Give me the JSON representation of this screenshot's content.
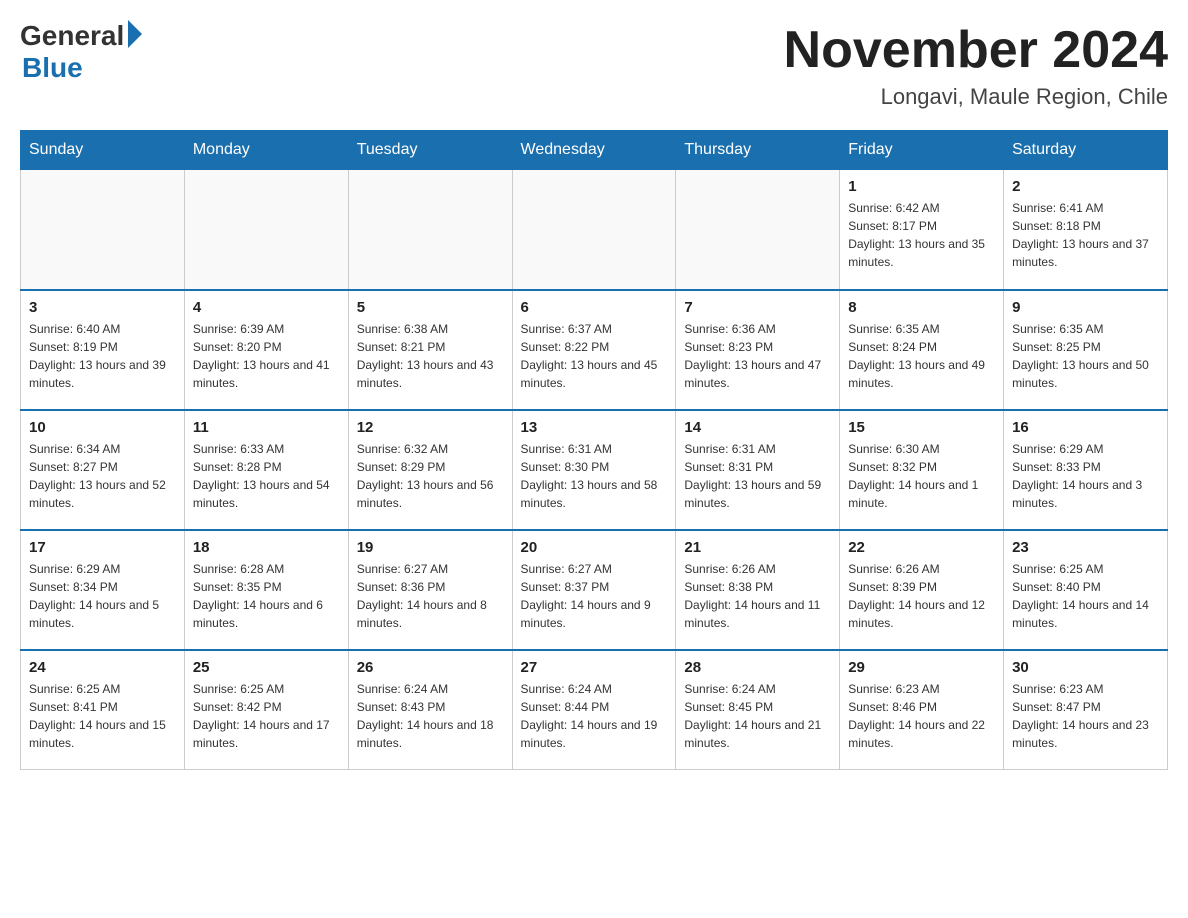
{
  "header": {
    "logo_general": "General",
    "logo_blue": "Blue",
    "month_title": "November 2024",
    "location": "Longavi, Maule Region, Chile"
  },
  "days_of_week": [
    "Sunday",
    "Monday",
    "Tuesday",
    "Wednesday",
    "Thursday",
    "Friday",
    "Saturday"
  ],
  "weeks": [
    [
      {
        "day": "",
        "info": ""
      },
      {
        "day": "",
        "info": ""
      },
      {
        "day": "",
        "info": ""
      },
      {
        "day": "",
        "info": ""
      },
      {
        "day": "",
        "info": ""
      },
      {
        "day": "1",
        "info": "Sunrise: 6:42 AM\nSunset: 8:17 PM\nDaylight: 13 hours and 35 minutes."
      },
      {
        "day": "2",
        "info": "Sunrise: 6:41 AM\nSunset: 8:18 PM\nDaylight: 13 hours and 37 minutes."
      }
    ],
    [
      {
        "day": "3",
        "info": "Sunrise: 6:40 AM\nSunset: 8:19 PM\nDaylight: 13 hours and 39 minutes."
      },
      {
        "day": "4",
        "info": "Sunrise: 6:39 AM\nSunset: 8:20 PM\nDaylight: 13 hours and 41 minutes."
      },
      {
        "day": "5",
        "info": "Sunrise: 6:38 AM\nSunset: 8:21 PM\nDaylight: 13 hours and 43 minutes."
      },
      {
        "day": "6",
        "info": "Sunrise: 6:37 AM\nSunset: 8:22 PM\nDaylight: 13 hours and 45 minutes."
      },
      {
        "day": "7",
        "info": "Sunrise: 6:36 AM\nSunset: 8:23 PM\nDaylight: 13 hours and 47 minutes."
      },
      {
        "day": "8",
        "info": "Sunrise: 6:35 AM\nSunset: 8:24 PM\nDaylight: 13 hours and 49 minutes."
      },
      {
        "day": "9",
        "info": "Sunrise: 6:35 AM\nSunset: 8:25 PM\nDaylight: 13 hours and 50 minutes."
      }
    ],
    [
      {
        "day": "10",
        "info": "Sunrise: 6:34 AM\nSunset: 8:27 PM\nDaylight: 13 hours and 52 minutes."
      },
      {
        "day": "11",
        "info": "Sunrise: 6:33 AM\nSunset: 8:28 PM\nDaylight: 13 hours and 54 minutes."
      },
      {
        "day": "12",
        "info": "Sunrise: 6:32 AM\nSunset: 8:29 PM\nDaylight: 13 hours and 56 minutes."
      },
      {
        "day": "13",
        "info": "Sunrise: 6:31 AM\nSunset: 8:30 PM\nDaylight: 13 hours and 58 minutes."
      },
      {
        "day": "14",
        "info": "Sunrise: 6:31 AM\nSunset: 8:31 PM\nDaylight: 13 hours and 59 minutes."
      },
      {
        "day": "15",
        "info": "Sunrise: 6:30 AM\nSunset: 8:32 PM\nDaylight: 14 hours and 1 minute."
      },
      {
        "day": "16",
        "info": "Sunrise: 6:29 AM\nSunset: 8:33 PM\nDaylight: 14 hours and 3 minutes."
      }
    ],
    [
      {
        "day": "17",
        "info": "Sunrise: 6:29 AM\nSunset: 8:34 PM\nDaylight: 14 hours and 5 minutes."
      },
      {
        "day": "18",
        "info": "Sunrise: 6:28 AM\nSunset: 8:35 PM\nDaylight: 14 hours and 6 minutes."
      },
      {
        "day": "19",
        "info": "Sunrise: 6:27 AM\nSunset: 8:36 PM\nDaylight: 14 hours and 8 minutes."
      },
      {
        "day": "20",
        "info": "Sunrise: 6:27 AM\nSunset: 8:37 PM\nDaylight: 14 hours and 9 minutes."
      },
      {
        "day": "21",
        "info": "Sunrise: 6:26 AM\nSunset: 8:38 PM\nDaylight: 14 hours and 11 minutes."
      },
      {
        "day": "22",
        "info": "Sunrise: 6:26 AM\nSunset: 8:39 PM\nDaylight: 14 hours and 12 minutes."
      },
      {
        "day": "23",
        "info": "Sunrise: 6:25 AM\nSunset: 8:40 PM\nDaylight: 14 hours and 14 minutes."
      }
    ],
    [
      {
        "day": "24",
        "info": "Sunrise: 6:25 AM\nSunset: 8:41 PM\nDaylight: 14 hours and 15 minutes."
      },
      {
        "day": "25",
        "info": "Sunrise: 6:25 AM\nSunset: 8:42 PM\nDaylight: 14 hours and 17 minutes."
      },
      {
        "day": "26",
        "info": "Sunrise: 6:24 AM\nSunset: 8:43 PM\nDaylight: 14 hours and 18 minutes."
      },
      {
        "day": "27",
        "info": "Sunrise: 6:24 AM\nSunset: 8:44 PM\nDaylight: 14 hours and 19 minutes."
      },
      {
        "day": "28",
        "info": "Sunrise: 6:24 AM\nSunset: 8:45 PM\nDaylight: 14 hours and 21 minutes."
      },
      {
        "day": "29",
        "info": "Sunrise: 6:23 AM\nSunset: 8:46 PM\nDaylight: 14 hours and 22 minutes."
      },
      {
        "day": "30",
        "info": "Sunrise: 6:23 AM\nSunset: 8:47 PM\nDaylight: 14 hours and 23 minutes."
      }
    ]
  ]
}
